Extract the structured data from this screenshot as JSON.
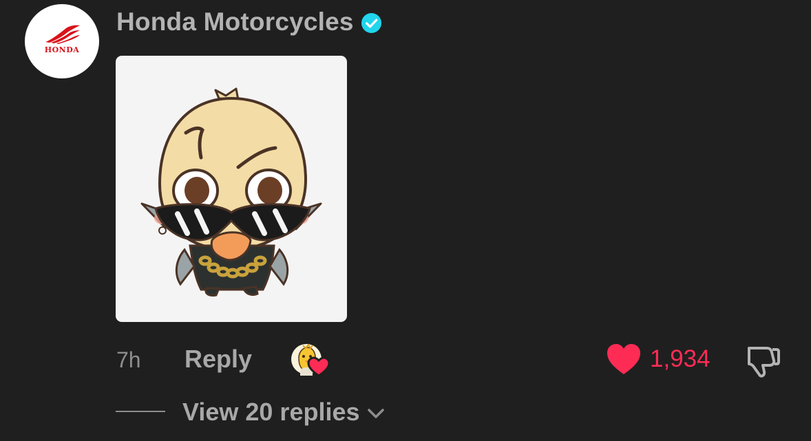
{
  "comment": {
    "author": {
      "name": "Honda Motorcycles",
      "verified": true,
      "avatar_text": "HONDA",
      "avatar_icon": "honda-wing-logo"
    },
    "sticker": {
      "icon": "chick-sunglasses-sticker"
    },
    "time_ago": "7h",
    "reply_label": "Reply",
    "creator_liked_icon": "creator-liked-badge-icon",
    "likes": "1,934",
    "view_replies_label": "View 20 replies"
  },
  "colors": {
    "background": "#1f1f1f",
    "accent_like": "#fe2c55",
    "verified_badge": "#20d5ec",
    "muted_text": "#a8a8a8",
    "brand_red": "#d8131b"
  }
}
